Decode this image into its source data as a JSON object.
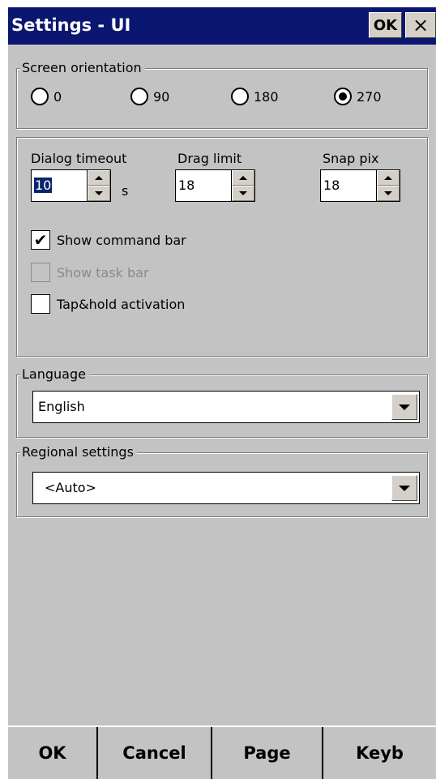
{
  "window": {
    "title": "Settings - UI",
    "ok_label": "OK",
    "close_label": "×"
  },
  "orientation": {
    "legend": "Screen orientation",
    "options": [
      "0",
      "90",
      "180",
      "270"
    ],
    "selected": "270"
  },
  "timeouts": {
    "dialog_timeout_label": "Dialog timeout",
    "dialog_timeout_value": "10",
    "dialog_timeout_unit": "s",
    "drag_limit_label": "Drag limit",
    "drag_limit_value": "18",
    "snap_pix_label": "Snap pix",
    "snap_pix_value": "18"
  },
  "checkboxes": [
    {
      "label": "Show command bar",
      "checked": true,
      "enabled": true
    },
    {
      "label": "Show task bar",
      "checked": false,
      "enabled": false
    },
    {
      "label": "Tap&hold activation",
      "checked": false,
      "enabled": true
    }
  ],
  "language": {
    "legend": "Language",
    "value": "English"
  },
  "regional": {
    "legend": "Regional settings",
    "value": "<Auto>"
  },
  "bottom_buttons": {
    "ok": "OK",
    "cancel": "Cancel",
    "page": "Page",
    "keyb": "Keyb"
  },
  "icons": {
    "check_mark": "✔",
    "close": "close-icon",
    "dropdown": "chevron-down-icon"
  },
  "colors": {
    "title_bar": "#0b1670",
    "background": "#c3c3c3",
    "selection": "#0a246a"
  }
}
